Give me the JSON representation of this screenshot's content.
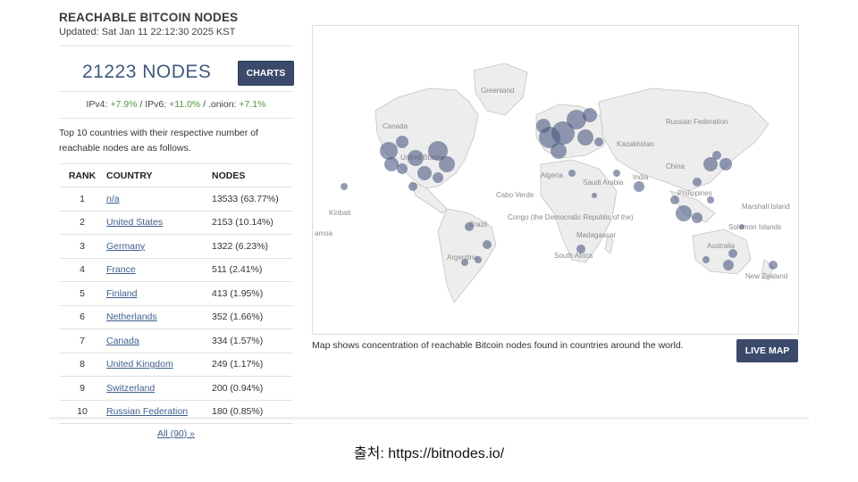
{
  "header": {
    "title": "REACHABLE BITCOIN NODES",
    "updated": "Updated: Sat Jan 11 22:12:30 2025 KST"
  },
  "summary": {
    "nodes": "21223 NODES",
    "charts_label": "CHARTS",
    "ipv4_label": "IPv4: ",
    "ipv4_value": "+7.9%",
    "ipv6_label": " / IPv6: ",
    "ipv6_value": "+11.0%",
    "onion_label": " / .onion: ",
    "onion_value": "+7.1%"
  },
  "description": "Top 10 countries with their respective number of reachable nodes are as follows.",
  "table": {
    "headers": [
      "RANK",
      "COUNTRY",
      "NODES"
    ],
    "rows": [
      {
        "rank": "1",
        "country": "n/a",
        "nodes": "13533 (63.77%)"
      },
      {
        "rank": "2",
        "country": "United States",
        "nodes": "2153 (10.14%)"
      },
      {
        "rank": "3",
        "country": "Germany",
        "nodes": "1322 (6.23%)"
      },
      {
        "rank": "4",
        "country": "France",
        "nodes": "511 (2.41%)"
      },
      {
        "rank": "5",
        "country": "Finland",
        "nodes": "413 (1.95%)"
      },
      {
        "rank": "6",
        "country": "Netherlands",
        "nodes": "352 (1.66%)"
      },
      {
        "rank": "7",
        "country": "Canada",
        "nodes": "334 (1.57%)"
      },
      {
        "rank": "8",
        "country": "United Kingdom",
        "nodes": "249 (1.17%)"
      },
      {
        "rank": "9",
        "country": "Switzerland",
        "nodes": "200 (0.94%)"
      },
      {
        "rank": "10",
        "country": "Russian Federation",
        "nodes": "180 (0.85%)"
      }
    ],
    "all_link": "All (90) »"
  },
  "map": {
    "labels": {
      "greenland": "Greenland",
      "canada": "Canada",
      "russia": "Russian Federation",
      "kazakhstan": "Kazakhstan",
      "china": "China",
      "algeria": "Algeria",
      "saudi": "Saudi Arabia",
      "india": "India",
      "philippines": "Philippines",
      "marshall": "Marshall Island",
      "solomon": "Solomon Islands",
      "kiribati": "Kiribati",
      "samoa": "amoa",
      "caboverde": "Cabo Verde",
      "congo": "Congo (the Democratic Republic of the)",
      "brazil": "Brazil",
      "argentina": "Argentina",
      "madagascar": "Madagascar",
      "southafrica": "South Africa",
      "australia": "Australia",
      "newzealand": "New Zealand",
      "usa": "United States"
    },
    "caption": "Map shows concentration of reachable Bitcoin nodes found in countries around the world.",
    "live_map_label": "LIVE MAP",
    "colors": {
      "land": "#ededed",
      "border": "#c4c4c4",
      "bubble": "#4b5a82"
    }
  },
  "source": "출처: https://bitnodes.io/"
}
